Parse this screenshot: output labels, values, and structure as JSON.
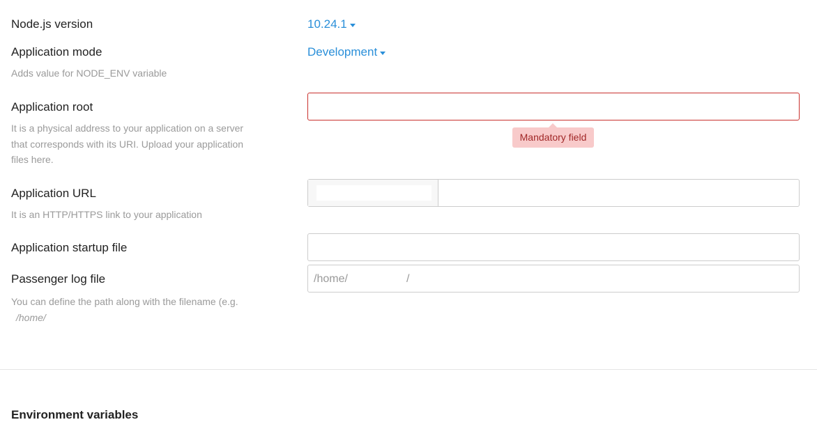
{
  "nodejs": {
    "label": "Node.js version",
    "value": "10.24.1"
  },
  "app_mode": {
    "label": "Application mode",
    "value": "Development",
    "hint": "Adds value for NODE_ENV variable"
  },
  "app_root": {
    "label": "Application root",
    "hint_line1": "It is a physical address to your application on a server",
    "hint_line2": "that corresponds with its URI. Upload your application",
    "hint_line3": "files here.",
    "value": "",
    "error": "Mandatory field"
  },
  "app_url": {
    "label": "Application URL",
    "hint": "It is an HTTP/HTTPS link to your application",
    "value": ""
  },
  "startup_file": {
    "label": "Application startup file",
    "value": ""
  },
  "passenger_log": {
    "label": "Passenger log file",
    "placeholder_prefix": "/home/",
    "placeholder_suffix": "/",
    "hint_line1": "You can define the path along with the filename (e.g.",
    "hint_line2": "/home/"
  },
  "env_section": {
    "title": "Environment variables"
  }
}
